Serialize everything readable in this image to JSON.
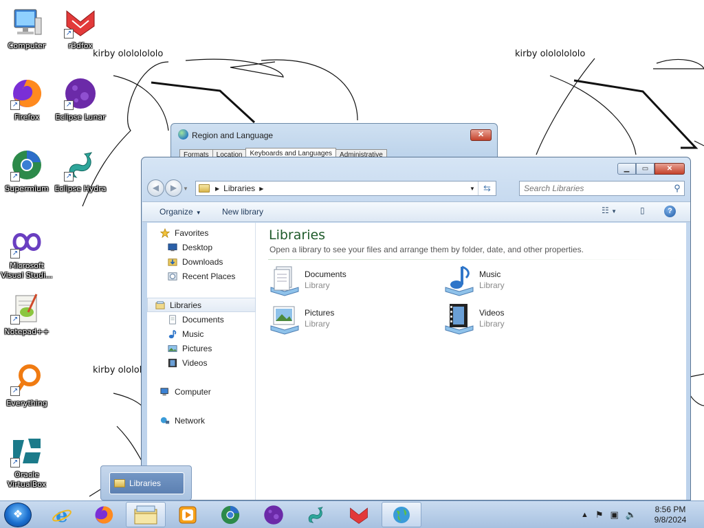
{
  "wallpaper": {
    "doodle_texts": [
      "kirby olololololo",
      "kirby olololololo",
      "kirby olololo"
    ]
  },
  "desktop": {
    "icons": [
      {
        "label": "Computer",
        "icon": "computer-icon"
      },
      {
        "label": "r3dfox",
        "icon": "r3dfox-icon"
      },
      {
        "label": "Firefox",
        "icon": "firefox-icon"
      },
      {
        "label": "Eclipse Lunar",
        "icon": "eclipse-lunar-icon"
      },
      {
        "label": "Supermium",
        "icon": "supermium-icon"
      },
      {
        "label": "Eclipse Hydra",
        "icon": "eclipse-hydra-icon"
      },
      {
        "label": "Microsoft Visual Studi...",
        "icon": "visual-studio-icon"
      },
      {
        "label": "Notepad++",
        "icon": "notepad-plus-plus-icon"
      },
      {
        "label": "Everything",
        "icon": "everything-icon"
      },
      {
        "label": "Oracle VirtualBox",
        "icon": "virtualbox-icon"
      }
    ]
  },
  "region_dialog": {
    "title": "Region and Language",
    "tabs": [
      "Formats",
      "Location",
      "Keyboards and Languages",
      "Administrative"
    ],
    "active_tab": "Keyboards and Languages"
  },
  "explorer": {
    "address": {
      "crumb": "Libraries"
    },
    "search": {
      "placeholder": "Search Libraries"
    },
    "toolbar": {
      "organize": "Organize",
      "new_library": "New library"
    },
    "nav": {
      "favorites": "Favorites",
      "desktop": "Desktop",
      "downloads": "Downloads",
      "recent_places": "Recent Places",
      "libraries": "Libraries",
      "documents": "Documents",
      "music": "Music",
      "pictures": "Pictures",
      "videos": "Videos",
      "computer": "Computer",
      "network": "Network"
    },
    "content": {
      "heading": "Libraries",
      "subtitle": "Open a library to see your files and arrange them by folder, date, and other properties.",
      "libraries": [
        {
          "name": "Documents",
          "type": "Library"
        },
        {
          "name": "Music",
          "type": "Library"
        },
        {
          "name": "Pictures",
          "type": "Library"
        },
        {
          "name": "Videos",
          "type": "Library"
        }
      ]
    }
  },
  "taskbar": {
    "thumbnail_label": "Libraries",
    "clock": {
      "time": "8:56 PM",
      "date": "9/8/2024"
    }
  },
  "colors": {
    "accent": "#1e5a2a",
    "window_frame": "#c3d7ee",
    "close_red": "#c4422b"
  }
}
